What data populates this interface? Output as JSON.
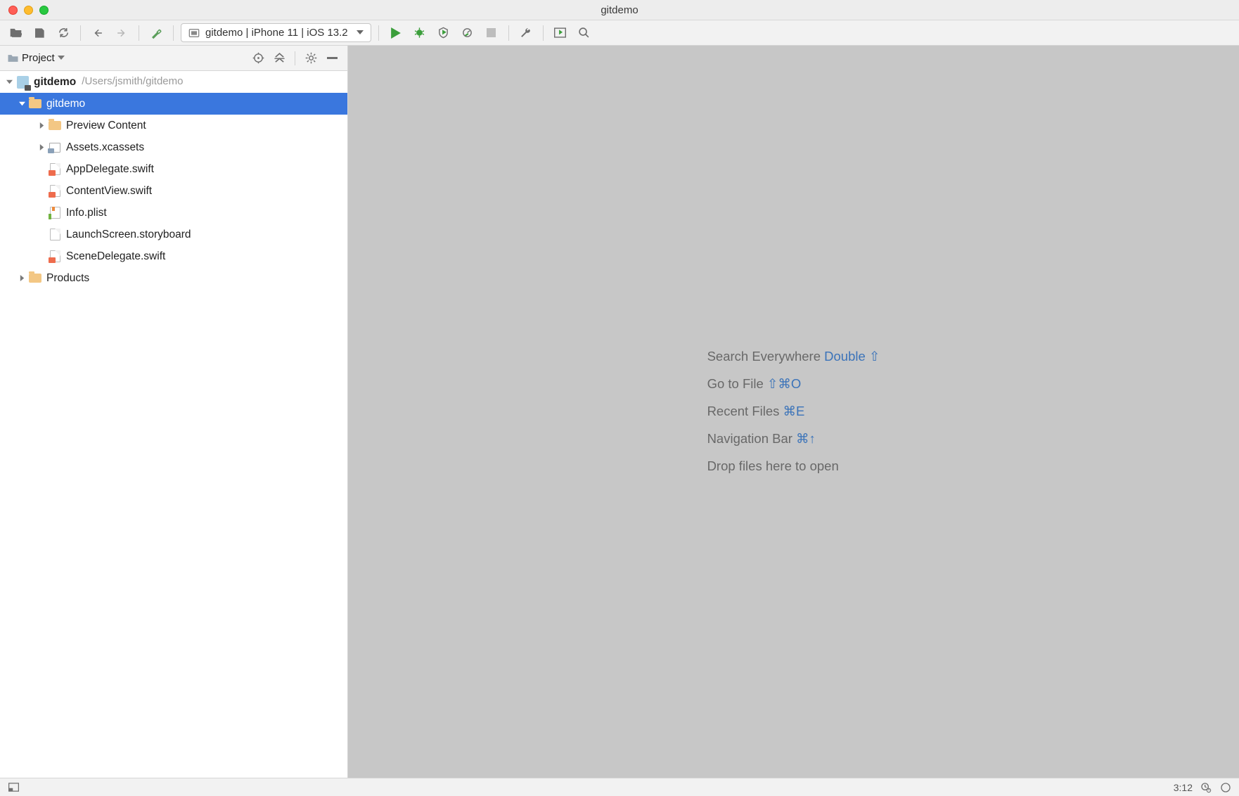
{
  "window": {
    "title": "gitdemo"
  },
  "toolbar": {
    "open_file": "Open",
    "save_all": "Save All",
    "reload": "Reload from Disk",
    "back": "Back",
    "forward": "Forward",
    "build": "Build Project",
    "run": "Run",
    "debug": "Debug",
    "coverage": "Run with Coverage",
    "profile": "Profile",
    "stop": "Stop",
    "wrench": "Configure",
    "layout": "Select Run/Debug Configuration",
    "search": "Search Everywhere"
  },
  "run_config": {
    "text": "gitdemo | iPhone 11 | iOS 13.2"
  },
  "sidebar": {
    "panel_label": "Project",
    "tools": {
      "locate": "Select Opened File",
      "expand": "Expand All",
      "settings": "Show Options Menu",
      "hide": "Hide"
    }
  },
  "tree": {
    "root": {
      "name": "gitdemo",
      "path": "/Users/jsmith/gitdemo"
    },
    "module": {
      "name": "gitdemo"
    },
    "items": [
      {
        "name": "Preview Content",
        "icon": "folder",
        "expandable": true
      },
      {
        "name": "Assets.xcassets",
        "icon": "assets",
        "expandable": true
      },
      {
        "name": "AppDelegate.swift",
        "icon": "swift",
        "expandable": false
      },
      {
        "name": "ContentView.swift",
        "icon": "swift",
        "expandable": false
      },
      {
        "name": "Info.plist",
        "icon": "plist",
        "expandable": false
      },
      {
        "name": "LaunchScreen.storyboard",
        "icon": "file",
        "expandable": false
      },
      {
        "name": "SceneDelegate.swift",
        "icon": "swift",
        "expandable": false
      }
    ],
    "products": {
      "name": "Products"
    }
  },
  "editor_tips": {
    "search": {
      "label": "Search Everywhere",
      "shortcut": "Double ⇧"
    },
    "goto": {
      "label": "Go to File",
      "shortcut": "⇧⌘O"
    },
    "recent": {
      "label": "Recent Files",
      "shortcut": "⌘E"
    },
    "navbar": {
      "label": "Navigation Bar",
      "shortcut": "⌘↑"
    },
    "drop": {
      "label": "Drop files here to open"
    }
  },
  "status": {
    "time": "3:12"
  }
}
